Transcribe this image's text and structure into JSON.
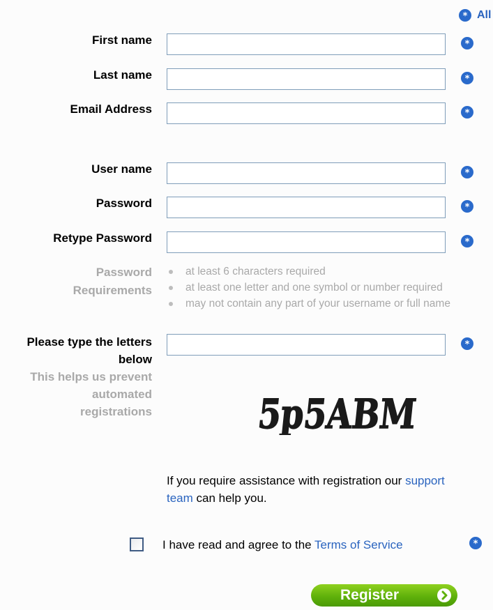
{
  "top_link": {
    "label": "All"
  },
  "fields": {
    "first_name": {
      "label": "First name",
      "value": ""
    },
    "last_name": {
      "label": "Last name",
      "value": ""
    },
    "email": {
      "label": "Email Address",
      "value": ""
    },
    "username": {
      "label": "User name",
      "value": ""
    },
    "password": {
      "label": "Password",
      "value": ""
    },
    "retype_password": {
      "label": "Retype Password",
      "value": ""
    }
  },
  "password_requirements": {
    "label_line1": "Password",
    "label_line2": "Requirements",
    "items": [
      "at least 6 characters required",
      "at least one letter and one symbol or number required",
      "may not contain any part of your username or full name"
    ]
  },
  "captcha": {
    "label_line1": "Please type the letters",
    "label_line2": "below",
    "help_line1": "This helps us prevent",
    "help_line2": "automated",
    "help_line3": "registrations",
    "value": "",
    "image_text": "5p5ABM"
  },
  "assistance": {
    "text_before": "If you require assistance with registration our ",
    "link": "support team",
    "text_after": " can help you."
  },
  "tos": {
    "text_before": "I have read and agree to the ",
    "link": "Terms of Service",
    "checked": false
  },
  "register": {
    "label": "Register"
  },
  "colors": {
    "accent_blue": "#2a64bf",
    "required_icon": "#2a6acb",
    "register_green": "#5fb10b",
    "muted_text": "#a9a9a9"
  }
}
